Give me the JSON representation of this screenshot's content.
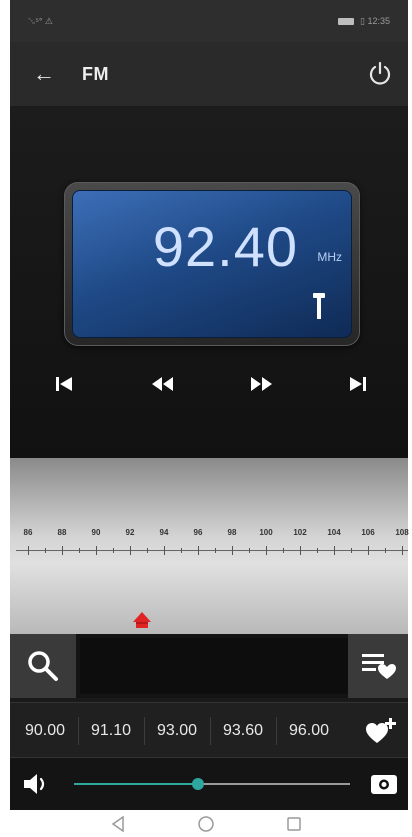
{
  "status_bar": {
    "left": "␖⁵ᐤ ⚠",
    "right": "▯ 12:35"
  },
  "app_bar": {
    "title": "FM",
    "back_icon": "arrow-left-icon",
    "power_icon": "power-icon"
  },
  "tuner_display": {
    "frequency": "92.40",
    "unit": "MHz",
    "antenna_icon": "antenna-icon"
  },
  "controls": [
    {
      "name": "previous-station-button",
      "icon": "skip-previous-icon"
    },
    {
      "name": "seek-backward-button",
      "icon": "rewind-icon"
    },
    {
      "name": "seek-forward-button",
      "icon": "fast-forward-icon"
    },
    {
      "name": "next-station-button",
      "icon": "skip-next-icon"
    }
  ],
  "scale": {
    "labels": [
      "86",
      "88",
      "90",
      "92",
      "94",
      "96",
      "98",
      "100",
      "102",
      "104",
      "106",
      "108"
    ],
    "current_frequency": 92.4,
    "range": [
      86,
      108
    ]
  },
  "actions": {
    "search_icon": "search-icon",
    "favorites_icon": "favorites-list-icon"
  },
  "presets": [
    "90.00",
    "91.10",
    "93.00",
    "93.60",
    "96.00"
  ],
  "add_favorite_icon": "add-favorite-icon",
  "volume": {
    "level": 0.45,
    "speaker_icon": "speaker-icon",
    "record_icon": "record-icon"
  },
  "nav": [
    "back-nav-icon",
    "home-nav-icon",
    "recents-nav-icon"
  ],
  "colors": {
    "accent": "#2fa7a1",
    "pointer": "#e02424",
    "display": "#1f4a87"
  }
}
